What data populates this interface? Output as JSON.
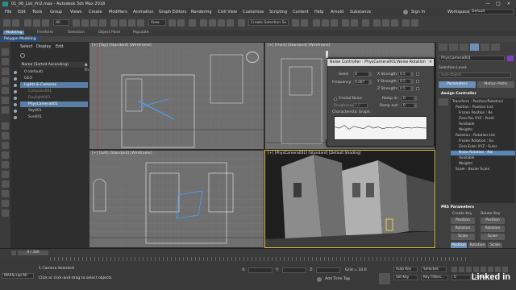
{
  "window": {
    "title": "01_06_List_Pri2.max - Autodesk 3ds Max 2018",
    "controls": [
      "—",
      "□",
      "×"
    ]
  },
  "menu": [
    "File",
    "Edit",
    "Tools",
    "Group",
    "Views",
    "Create",
    "Modifiers",
    "Animation",
    "Graph Editors",
    "Rendering",
    "Civil View",
    "Customize",
    "Scripting",
    "Content",
    "Help",
    "Arnold",
    "Substance"
  ],
  "account": {
    "signin": "Sign In",
    "workspaces_label": "Workspaces:",
    "workspace": "Default"
  },
  "toolbar": {
    "filter_value": "All",
    "view_value": "View",
    "selection_set_placeholder": "Create Selection Se"
  },
  "ribbon": {
    "tabs": [
      "Modeling",
      "Freeform",
      "Selection",
      "Object Paint",
      "Populate"
    ],
    "active_tab": "Modeling",
    "sub_label": "Polygon Modeling"
  },
  "explorer": {
    "tabs": [
      "Select",
      "Display",
      "Edit"
    ],
    "header": "Name (Sorted Ascending)",
    "header_right": "▲ Frozen",
    "items": [
      {
        "label": "0 (default)",
        "selected": false,
        "dim": false,
        "indent": 1
      },
      {
        "label": "GEO",
        "selected": false,
        "dim": false,
        "indent": 1
      },
      {
        "label": "Lights & Cameras",
        "selected": true,
        "dim": false,
        "indent": 1
      },
      {
        "label": "Compass001",
        "selected": false,
        "dim": true,
        "indent": 2
      },
      {
        "label": "Daylight001",
        "selected": false,
        "dim": true,
        "indent": 2
      },
      {
        "label": "PhysCamera001",
        "selected": true,
        "dim": false,
        "indent": 2
      },
      {
        "label": "Sky001",
        "selected": false,
        "dim": false,
        "indent": 2
      },
      {
        "label": "Sun001",
        "selected": false,
        "dim": false,
        "indent": 2
      }
    ]
  },
  "viewports": {
    "top": "[+] [Top] [Standard] [Wireframe]",
    "front": "[+] [Front] [Standard] [Wireframe]",
    "left": "[+] [Left] [Standard] [Wireframe]",
    "camera": "[+] [PhysCamera001] [Standard] [Default Shading]"
  },
  "noise_dialog": {
    "title": "Noise Controller : PhysCamera001\\Noise Rotation",
    "seed_label": "Seed:",
    "seed": "0",
    "frequency_label": "Frequency:",
    "frequency": "0.007",
    "x_label": "X Strength:",
    "x_value": "0.5",
    "y_label": "Y Strength:",
    "y_value": "0.5",
    "z_label": "Z Strength:",
    "z_value": "0.5",
    "fractal_label": "Fractal Noise",
    "roughness_label": "Roughness:",
    "roughness": "0.0",
    "ramp_in_label": "Ramp in:",
    "ramp_in": "0",
    "ramp_out_label": "Ramp out:",
    "ramp_out": "0",
    "graph_label": "Characteristic Graph:",
    "curve": [
      0.55,
      0.5,
      0.62,
      0.45,
      0.58,
      0.52,
      0.48,
      0.6,
      0.5,
      0.55,
      0.47,
      0.53,
      0.5,
      0.56,
      0.49,
      0.52,
      0.5,
      0.54,
      0.51,
      0.5
    ]
  },
  "command_panel": {
    "object_name": "PhysCamera001",
    "selection_level_label": "Selection Level:",
    "sub_object": "Sub-Object",
    "params_btn": "Parameters",
    "motion_btn": "Motion Paths",
    "assign_header": "Assign Controller",
    "tree": [
      {
        "label": "Transform : Position/Rotation/",
        "sel": false,
        "indent": 0
      },
      {
        "label": "Position : Position List",
        "sel": false,
        "indent": 1
      },
      {
        "label": "Frozen Position : Be",
        "sel": false,
        "indent": 2
      },
      {
        "label": "Zero Pos XYZ : Positi",
        "sel": false,
        "indent": 2
      },
      {
        "label": "Available",
        "sel": false,
        "indent": 2
      },
      {
        "label": "Weights",
        "sel": false,
        "indent": 2
      },
      {
        "label": "Rotation : Rotation List",
        "sel": false,
        "indent": 1
      },
      {
        "label": "Frozen Rotation : Eu",
        "sel": false,
        "indent": 2
      },
      {
        "label": "Zero Euler XYZ : Euler",
        "sel": false,
        "indent": 2
      },
      {
        "label": "Noise Rotation : Noi",
        "sel": true,
        "indent": 2
      },
      {
        "label": "Available",
        "sel": false,
        "indent": 2
      },
      {
        "label": "Weights",
        "sel": false,
        "indent": 2
      },
      {
        "label": "Scale : Bezier Scale",
        "sel": false,
        "indent": 1
      }
    ],
    "prs_header": "PRS Parameters",
    "create_key": "Create Key",
    "delete_key": "Delete Key",
    "btn_position": "Position",
    "btn_rotation": "Rotation",
    "btn_scale": "Scale",
    "bottom_tabs": [
      "Position",
      "Rotation",
      "Scale"
    ]
  },
  "timeline": {
    "frame": "0 / 300",
    "auto_key": "Auto Key",
    "selected": "Selected",
    "set_key": "Set Key",
    "key_filters": "Key Filters..."
  },
  "status": {
    "maxscript": "MAXScript Mi:",
    "selection": "1 Camera Selected",
    "prompt": "Click or click-and-drag to select objects",
    "x_label": "X:",
    "y_label": "Y:",
    "z_label": "Z:",
    "grid": "Grid = 10.0",
    "add_time_tag": "Add Time Tag",
    "frame_value": "0",
    "auto_key": "Auto Key",
    "selected": "Selected",
    "set_key": "Set Key",
    "key_filters": "Key Filters...",
    "default_label": "Default"
  },
  "watermark": "Linked in"
}
